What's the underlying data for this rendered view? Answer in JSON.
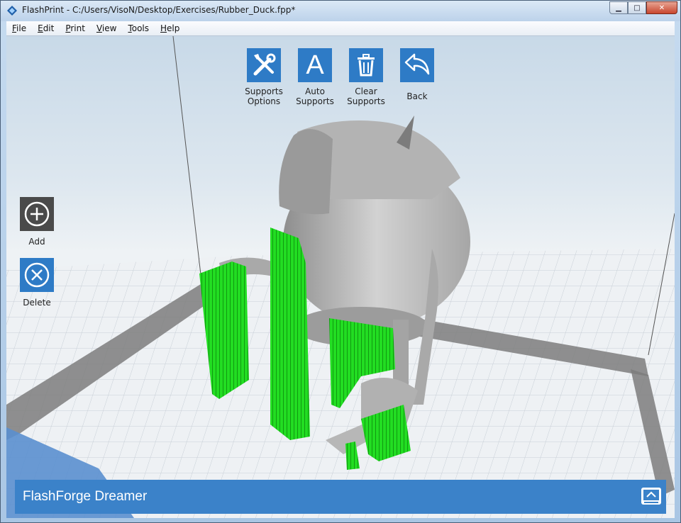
{
  "window": {
    "title": "FlashPrint - C:/Users/VisoN/Desktop/Exercises/Rubber_Duck.fpp*",
    "controls": {
      "minimize": "▁",
      "maximize": "□",
      "close": "✕"
    }
  },
  "menu": [
    {
      "key": "F",
      "rest": "ile"
    },
    {
      "key": "E",
      "rest": "dit"
    },
    {
      "key": "P",
      "rest": "rint"
    },
    {
      "key": "V",
      "rest": "iew"
    },
    {
      "key": "T",
      "rest": "ools"
    },
    {
      "key": "H",
      "rest": "elp"
    }
  ],
  "toolbar": {
    "supports_options": {
      "line1": "Supports",
      "line2": "Options",
      "icon": "tools-icon"
    },
    "auto_supports": {
      "line1": "Auto",
      "line2": "Supports",
      "icon": "letter-a-icon",
      "glyph": "A"
    },
    "clear_supports": {
      "line1": "Clear",
      "line2": "Supports",
      "icon": "trash-icon"
    },
    "back": {
      "label": "Back",
      "icon": "undo-arrow-icon"
    }
  },
  "sidebar": {
    "add": {
      "label": "Add",
      "icon": "plus-circle-icon"
    },
    "delete": {
      "label": "Delete",
      "icon": "x-circle-icon"
    }
  },
  "status": {
    "printer_name": "FlashForge Dreamer",
    "machine_icon": "printer-machine-icon"
  },
  "colors": {
    "accent": "#2e7bc6",
    "support_green": "#22dd22",
    "model_gray": "#b9b9b9",
    "dark_tile": "#4a4a4a"
  }
}
